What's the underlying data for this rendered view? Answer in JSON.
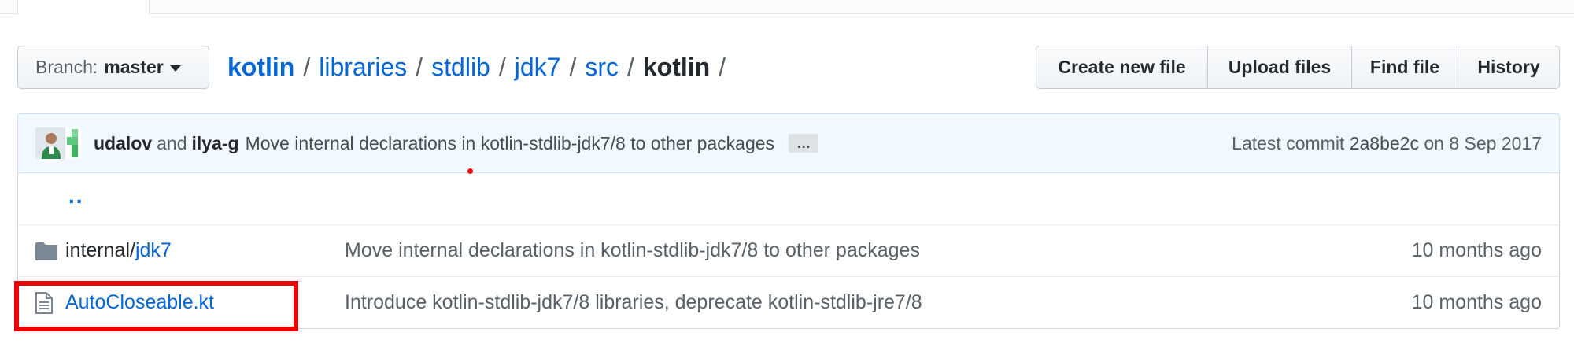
{
  "branch": {
    "label": "Branch:",
    "value": "master"
  },
  "breadcrumb": {
    "items": [
      "kotlin",
      "libraries",
      "stdlib",
      "jdk7",
      "src"
    ],
    "current": "kotlin",
    "separator": "/"
  },
  "actions": {
    "create": "Create new file",
    "upload": "Upload files",
    "find": "Find file",
    "history": "History"
  },
  "commit": {
    "author1": "udalov",
    "and": "and",
    "author2": "ilya-g",
    "message": "Move internal declarations in kotlin-stdlib-jdk7/8 to other packages",
    "ellipsis": "…",
    "latest_label": "Latest commit",
    "sha": "2a8be2c",
    "date_text": "on 8 Sep 2017"
  },
  "files": {
    "parent": "..",
    "rows": [
      {
        "icon": "folder-icon",
        "name_prefix": "internal/",
        "name": "jdk7",
        "message": "Move internal declarations in kotlin-stdlib-jdk7/8 to other packages",
        "age": "10 months ago"
      },
      {
        "icon": "file-icon",
        "name_prefix": "",
        "name": "AutoCloseable.kt",
        "message": "Introduce kotlin-stdlib-jdk7/8 libraries, deprecate kotlin-stdlib-jre7/8",
        "age": "10 months ago"
      }
    ]
  },
  "colors": {
    "link": "#0366d6",
    "commit_bg": "#f1f8ff",
    "highlight": "#ee0000"
  }
}
